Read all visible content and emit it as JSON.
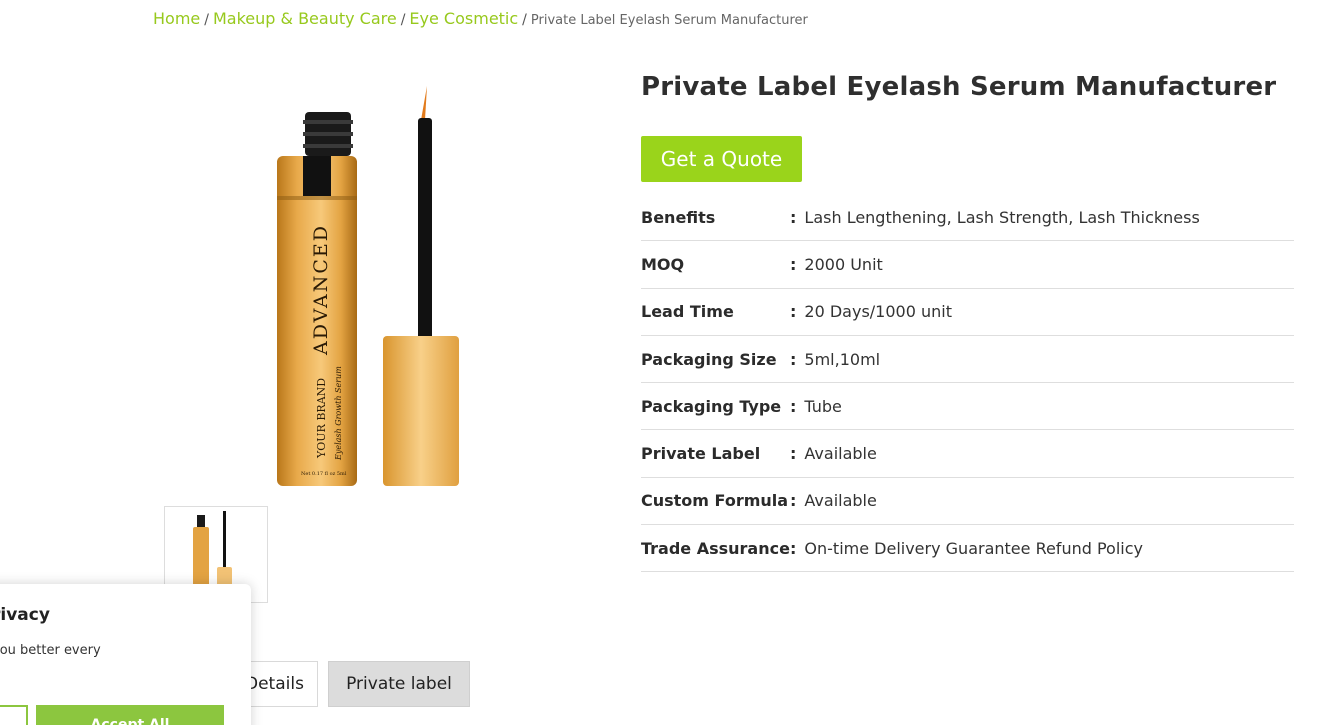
{
  "breadcrumb": {
    "items": [
      "Home",
      "Makeup & Beauty Care",
      "Eye Cosmetic"
    ],
    "separator": "/",
    "current": "Private Label Eyelash Serum Manufacturer"
  },
  "product": {
    "title": "Private Label Eyelash Serum Manufacturer",
    "quote_button": "Get a Quote",
    "bottle_text": {
      "brand_line": "YOUR BRAND",
      "name_line": "ADVANCED",
      "sub_line": "Eyelash Growth Serum",
      "net_line": "Net 0.17 fl oz 5ml"
    }
  },
  "specs": [
    {
      "label": "Benefits",
      "value": "Lash Lengthening, Lash Strength, Lash Thickness"
    },
    {
      "label": "MOQ",
      "value": "2000 Unit"
    },
    {
      "label": "Lead Time",
      "value": "20 Days/1000 unit"
    },
    {
      "label": "Packaging Size",
      "value": "5ml,10ml"
    },
    {
      "label": "Packaging Type",
      "value": "Tube"
    },
    {
      "label": "Private Label",
      "value": "Available"
    },
    {
      "label": "Custom Formula",
      "value": "Available"
    },
    {
      "label": "Trade Assurance",
      "value": "On-time Delivery Guarantee Refund Policy"
    }
  ],
  "spec_colon": ":",
  "tabs": {
    "details": "Details",
    "private_label": "Private label"
  },
  "cookie": {
    "title": "rivacy",
    "text": "you better every",
    "accept_label": "Accept All"
  },
  "colors": {
    "accent_green": "#9ad41b",
    "link_green": "#97c91d",
    "gold": "#e0a945"
  }
}
